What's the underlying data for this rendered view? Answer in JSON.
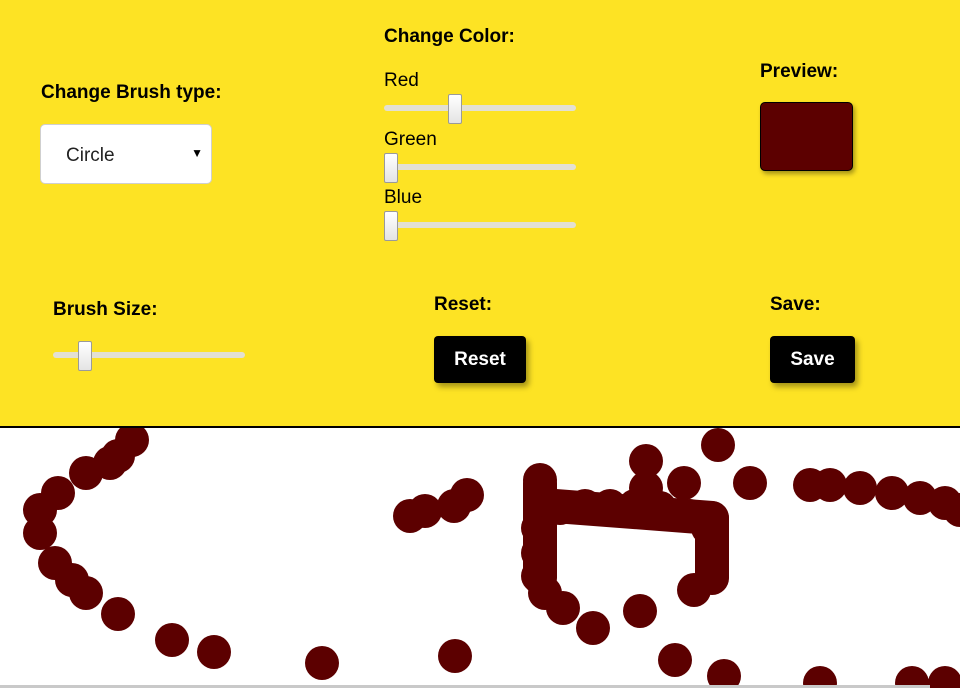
{
  "brush_type": {
    "heading": "Change Brush type:",
    "selected": "Circle",
    "arrow_icon": "triangle-down-icon"
  },
  "color": {
    "heading": "Change Color:",
    "red_label": "Red",
    "green_label": "Green",
    "blue_label": "Blue",
    "red_level": 0.36,
    "green_level": 0.0,
    "blue_level": 0.0
  },
  "preview": {
    "heading": "Preview:",
    "color": "#5c0000"
  },
  "brush_size": {
    "heading": "Brush Size:",
    "level": 0.14
  },
  "reset": {
    "heading": "Reset:",
    "button_label": "Reset"
  },
  "save": {
    "heading": "Save:",
    "button_label": "Save"
  },
  "colors": {
    "toolbar_bg": "#fde324",
    "stroke": "#5c0000",
    "button_bg": "#000000"
  }
}
